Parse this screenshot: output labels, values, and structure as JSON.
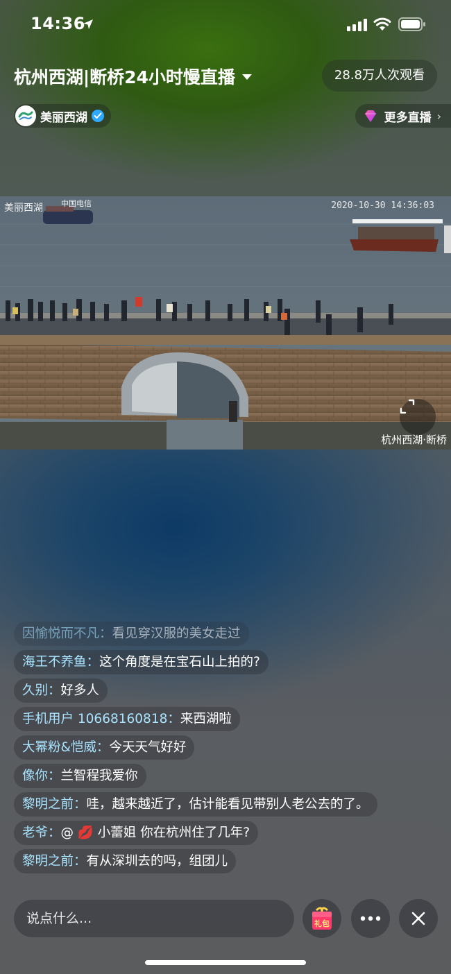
{
  "status_bar": {
    "time": "14:36"
  },
  "header": {
    "title": "杭州西湖|断桥24小时慢直播",
    "viewers": "28.8万人次观看",
    "channel_name": "美丽西湖",
    "more_live": "更多直播"
  },
  "video": {
    "watermark_logo": "美丽西湖",
    "watermark_telecom": "中国电信",
    "timestamp": "2020-10-30 14:36:03",
    "location_label": "杭州西湖·断桥"
  },
  "comments": [
    {
      "user": "因愉悦而不凡：",
      "text": "看见穿汉服的美女走过",
      "faded": true
    },
    {
      "user": "海王不养鱼：",
      "text": "这个角度是在宝石山上拍的?"
    },
    {
      "user": "久别：",
      "text": "好多人"
    },
    {
      "user": "手机用户 10668160818：",
      "text": "来西湖啦"
    },
    {
      "user": "大幂粉&恺威：",
      "text": "今天天气好好"
    },
    {
      "user": "像你：",
      "text": "兰智程我爱你"
    },
    {
      "user": "黎明之前：",
      "text": "哇，越来越近了，估计能看见带别人老公去的了。"
    },
    {
      "user": "老爷：",
      "text": "@ 💋 小蕾姐 你在杭州住了几年?"
    },
    {
      "user": "黎明之前：",
      "text": "有从深圳去的吗，组团儿"
    }
  ],
  "bottom_bar": {
    "input_placeholder": "说点什么...",
    "gift_label": "礼包"
  },
  "colors": {
    "username": "#a8e4ff",
    "verified": "#2fa8ff",
    "accent_pink": "#ff3b6b"
  }
}
